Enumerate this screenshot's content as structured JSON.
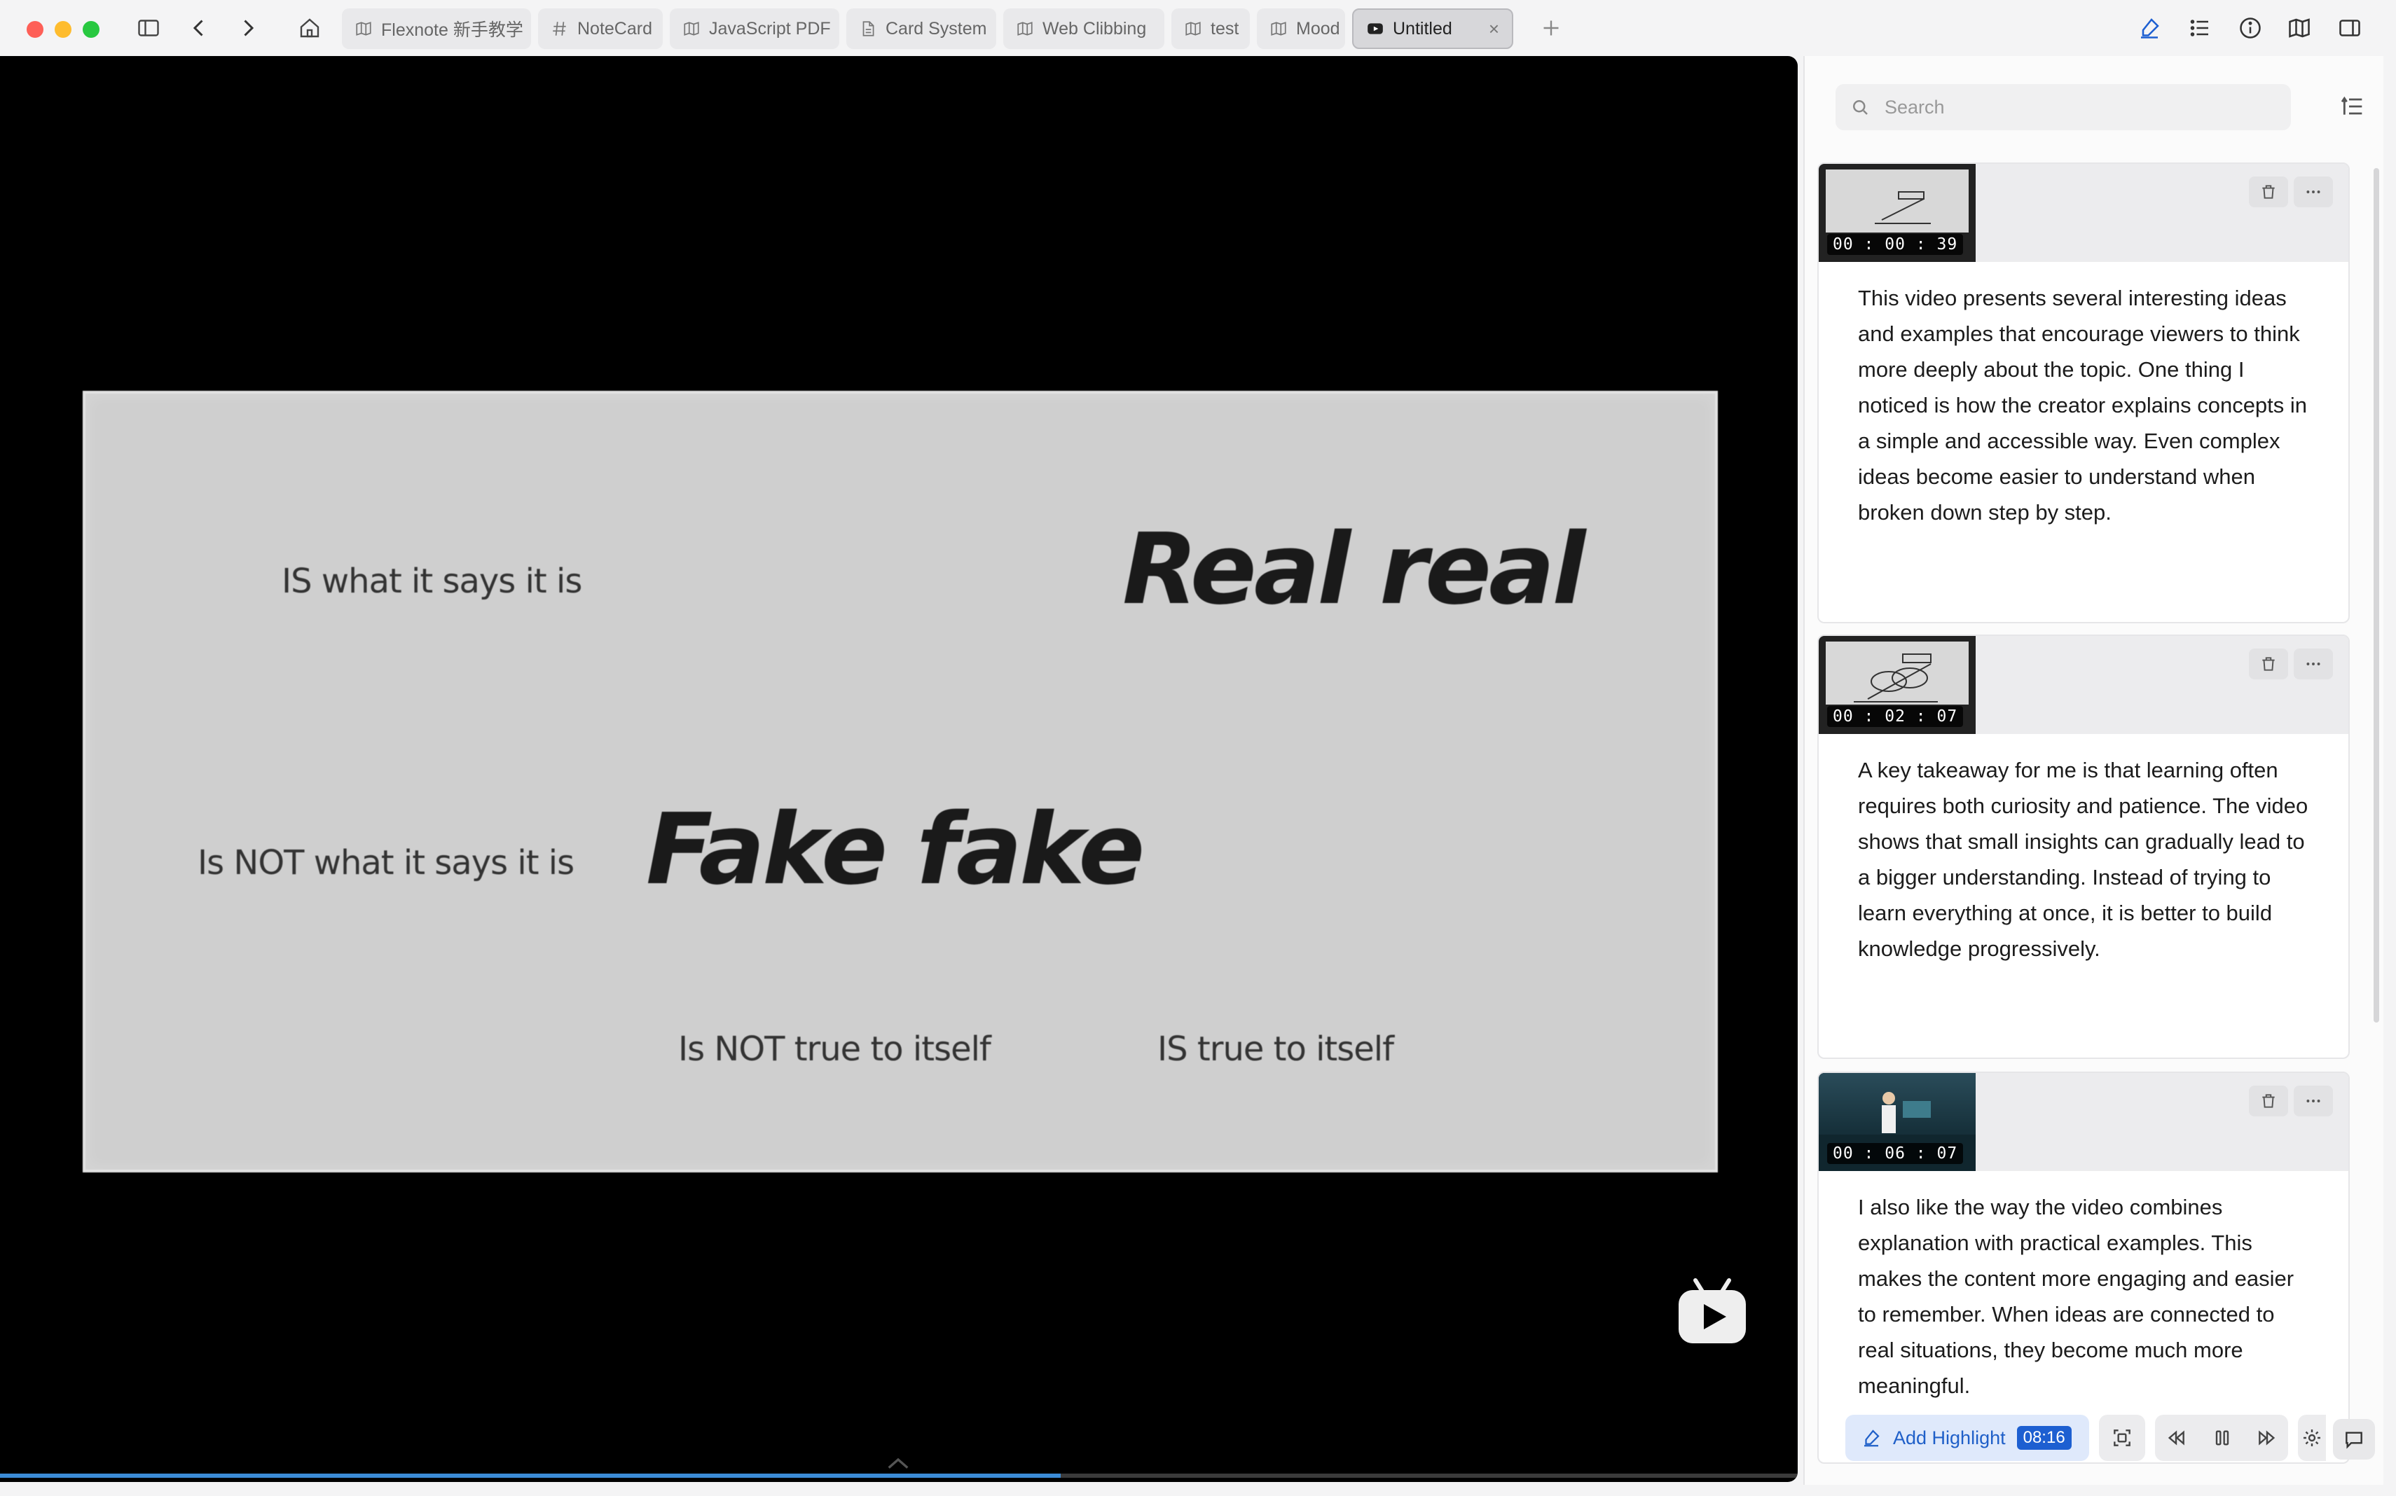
{
  "window": {
    "tabs": [
      {
        "label": "Flexnote 新手教学",
        "icon": "map-icon"
      },
      {
        "label": "NoteCard",
        "icon": "hash-icon"
      },
      {
        "label": "JavaScript PDF",
        "icon": "map-icon"
      },
      {
        "label": "Card System",
        "icon": "document-icon"
      },
      {
        "label": "Web Clibbing",
        "icon": "map-icon"
      },
      {
        "label": "test",
        "icon": "map-icon"
      },
      {
        "label": "Mood",
        "icon": "map-icon"
      },
      {
        "label": "Untitled",
        "icon": "video-icon",
        "active": true
      }
    ],
    "new_tab_label": "+"
  },
  "video": {
    "slide": {
      "line1_left": "IS what it says it is",
      "line1_right": "Real real",
      "line2_left": "Is NOT what it says it is",
      "line2_right": "Fake fake",
      "line3_left": "Is NOT true to itself",
      "line3_right": "IS true to itself"
    },
    "progress_fraction": 0.59
  },
  "sidebar": {
    "search": {
      "placeholder": "Search",
      "value": ""
    },
    "highlights": [
      {
        "timestamp": "00 : 00 : 39",
        "thumb": "slide",
        "text": "This video presents several interesting ideas and examples that encourage viewers to think more deeply about the topic. One thing I noticed is how the creator explains concepts in a simple and accessible way. Even complex ideas become easier to understand when broken down step by step."
      },
      {
        "timestamp": "00 : 02 : 07",
        "thumb": "slide",
        "text": "A key takeaway for me is that learning often requires both curiosity and patience. The video shows that small insights can gradually lead to a bigger understanding. Instead of trying to learn everything at once, it is better to build knowledge progressively."
      },
      {
        "timestamp": "00 : 06 : 07",
        "thumb": "stage",
        "text": "I also like the way the video combines explanation with practical examples. This makes the content more engaging and easier to remember. When ideas are connected to real situations, they become much more meaningful."
      }
    ]
  },
  "controls": {
    "add_highlight_label": "Add Highlight",
    "current_time": "08:16"
  },
  "colors": {
    "accent": "#1d5fd1",
    "video_bg": "#000000",
    "traffic_red": "#fe5f57",
    "traffic_yellow": "#febc2e",
    "traffic_green": "#28c840"
  }
}
